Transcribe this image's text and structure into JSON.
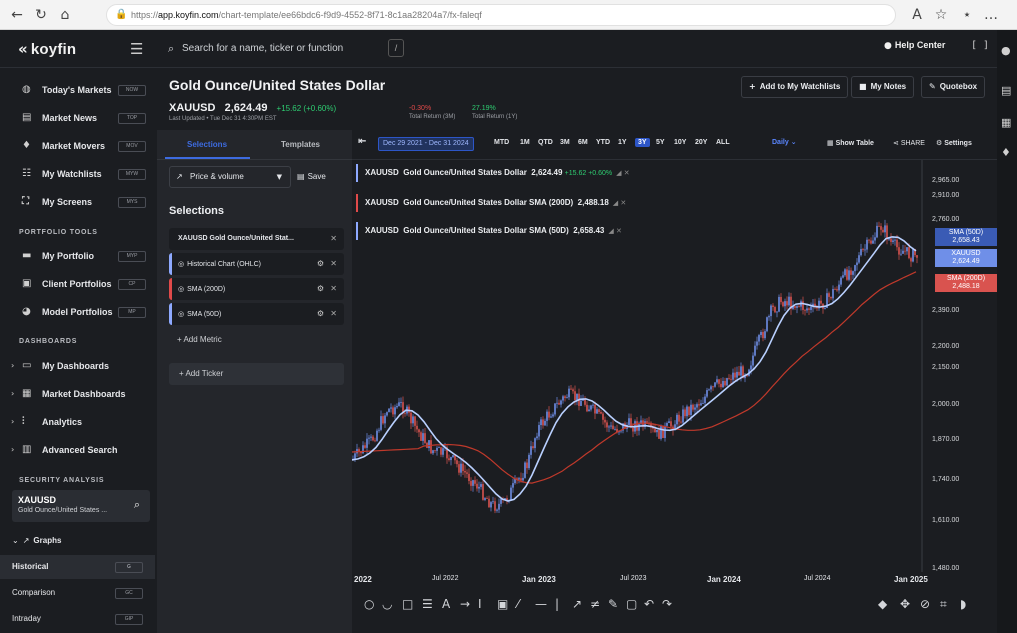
{
  "browser": {
    "url_host": "app.koyfin.com",
    "url_prefix": "https://",
    "url_path": "/chart-template/ee66bdc6-f9d9-4552-8f71-8c1aa28204a7/fx-faleqf"
  },
  "topbar": {
    "logo": "koyfin",
    "search_placeholder": "Search for a name, ticker or function",
    "search_shortcut": "/",
    "help": "Help Center"
  },
  "sidebar": {
    "items": [
      {
        "label": "Today's Markets",
        "code": "NOW"
      },
      {
        "label": "Market News",
        "code": "TOP"
      },
      {
        "label": "Market Movers",
        "code": "MOV"
      },
      {
        "label": "My Watchlists",
        "code": "MYW"
      },
      {
        "label": "My Screens",
        "code": "MYS"
      }
    ],
    "portfolio_header": "PORTFOLIO TOOLS",
    "portfolio_items": [
      {
        "label": "My Portfolio",
        "code": "MYP"
      },
      {
        "label": "Client Portfolios",
        "code": "CP"
      },
      {
        "label": "Model Portfolios",
        "code": "MP"
      }
    ],
    "dashboards_header": "DASHBOARDS",
    "dashboard_items": [
      {
        "label": "My Dashboards"
      },
      {
        "label": "Market Dashboards"
      },
      {
        "label": "Analytics"
      },
      {
        "label": "Advanced Search"
      }
    ],
    "security_header": "SECURITY ANALYSIS",
    "security": {
      "ticker": "XAUUSD",
      "name": "Gold Ounce/United States ..."
    },
    "graphs_label": "Graphs",
    "graph_items": [
      {
        "label": "Historical",
        "code": "G"
      },
      {
        "label": "Comparison",
        "code": "GC"
      },
      {
        "label": "Intraday",
        "code": "GIP"
      }
    ]
  },
  "header": {
    "title": "Gold Ounce/United States Dollar",
    "ticker": "XAUUSD",
    "price": "2,624.49",
    "change": "+15.62 (+0.60%)",
    "last_updated": "Last Updated • Tue Dec 31 4:30PM EST",
    "ret_3m_value": "-0.30%",
    "ret_3m_label": "Total Return (3M)",
    "ret_1y_value": "27.19%",
    "ret_1y_label": "Total Return (1Y)",
    "btn_watchlist": "Add to My Watchlists",
    "btn_notes": "My Notes",
    "btn_quotebox": "Quotebox"
  },
  "leftpanel": {
    "tab_selections": "Selections",
    "tab_templates": "Templates",
    "pv_label": "Price & volume",
    "save_label": "Save",
    "selections_title": "Selections",
    "rows": [
      {
        "label": "XAUUSD  Gold Ounce/United Stat...",
        "color": "#2e2f35"
      },
      {
        "label": "Historical Chart (OHLC)",
        "color": "#8ea9ff"
      },
      {
        "label": "SMA (200D)",
        "color": "#e04a4a"
      },
      {
        "label": "SMA (50D)",
        "color": "#8ea9ff"
      }
    ],
    "add_metric": "+  Add Metric",
    "add_ticker": "+  Add Ticker"
  },
  "toolbar": {
    "date_range": "Dec 29 2021 - Dec 31 2024",
    "periods": [
      "MTD",
      "1M",
      "QTD",
      "3M",
      "6M",
      "YTD",
      "1Y",
      "3Y",
      "5Y",
      "10Y",
      "20Y",
      "ALL"
    ],
    "selected_period": "3Y",
    "interval": "Daily",
    "show_table": "Show Table",
    "share": "SHARE",
    "settings": "Settings"
  },
  "legend": [
    {
      "ticker": "XAUUSD",
      "name": "Gold Ounce/United States Dollar",
      "value": "2,624.49",
      "change": "+15.62 +0.60%",
      "color": "#8ea9ff"
    },
    {
      "ticker": "XAUUSD",
      "name": "Gold Ounce/United States Dollar  SMA (200D)",
      "value": "2,488.18",
      "color": "#e04a4a"
    },
    {
      "ticker": "XAUUSD",
      "name": "Gold Ounce/United States Dollar  SMA (50D)",
      "value": "2,658.43",
      "color": "#8ea9ff"
    }
  ],
  "axis": {
    "price_labels": [
      "2,965.00",
      "2,910.00",
      "2,760.00",
      "2,390.00",
      "2,200.00",
      "2,150.00",
      "2,000.00",
      "1,870.00",
      "1,740.00",
      "1,610.00",
      "1,480.00"
    ],
    "date_labels": [
      "2022",
      "Jul 2022",
      "Jan 2023",
      "Jul 2023",
      "Jan 2024",
      "Jul 2024",
      "Jan 2025"
    ],
    "tag_sma50": "SMA (50D)\n2,658.43",
    "tag_price": "XAUUSD\n2,624.49",
    "tag_sma200": "SMA (200D)\n2,488.18"
  },
  "colors": {
    "up": "#2ecc71",
    "candle_up": "#6f8fe8",
    "candle_down": "#d9534f",
    "sma50": "#b9d0ff",
    "sma200": "#c0392b",
    "accent": "#2d56c8"
  }
}
